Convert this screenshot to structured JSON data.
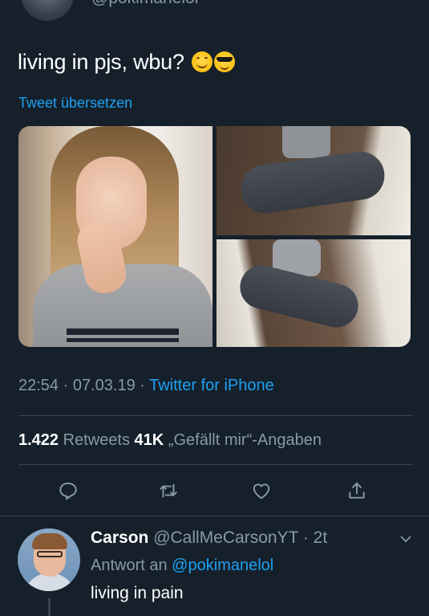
{
  "top": {
    "handle": "@pokimanelol"
  },
  "tweet": {
    "text": "living in pjs, wbu?",
    "emojis": [
      "smiling-face-icon",
      "sunglasses-face-icon"
    ],
    "translate_label": "Tweet übersetzen"
  },
  "media": {
    "photo_count": 3
  },
  "meta": {
    "time": "22:54",
    "sep1": " · ",
    "date": "07.03.19",
    "sep2": " · ",
    "source": "Twitter for iPhone"
  },
  "stats": {
    "retweets_count": "1.422",
    "retweets_label": " Retweets  ",
    "likes_count": "41K",
    "likes_label": " „Gefällt mir“-Angaben"
  },
  "actions": [
    "reply-icon",
    "retweet-icon",
    "like-icon",
    "share-icon"
  ],
  "reply": {
    "name": "Carson",
    "handle": " @CallMeCarsonYT · 2t",
    "reply_to_prefix": "Antwort an ",
    "reply_to_mention": "@pokimanelol",
    "text": "living in pain"
  },
  "colors": {
    "background": "#15202b",
    "accent": "#1da1f2",
    "secondary_text": "#8899a6",
    "divider": "#38444d"
  }
}
